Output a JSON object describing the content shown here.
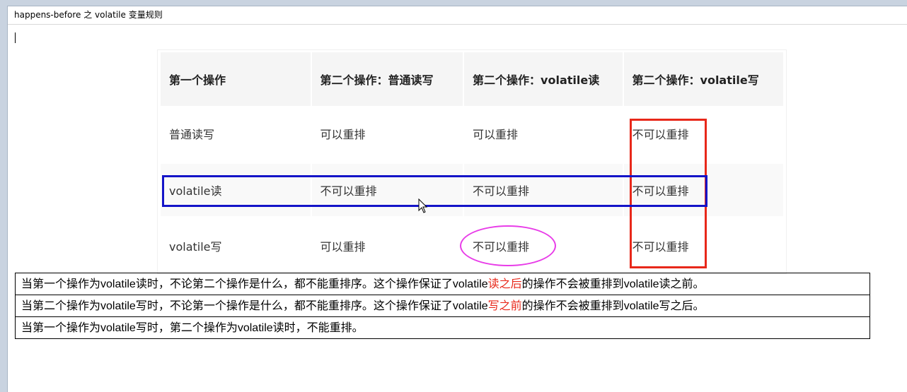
{
  "window": {
    "title": "happens-before 之 volatile 变量规则"
  },
  "table": {
    "headers": [
      "第一个操作",
      "第二个操作：普通读写",
      "第二个操作：volatile读",
      "第二个操作：volatile写"
    ],
    "rows": [
      [
        "普通读写",
        "可以重排",
        "可以重排",
        "不可以重排"
      ],
      [
        "volatile读",
        "不可以重排",
        "不可以重排",
        "不可以重排"
      ],
      [
        "volatile写",
        "可以重排",
        "不可以重排",
        "不可以重排"
      ]
    ]
  },
  "annotations": {
    "red_box_color": "#e8281a",
    "blue_box_color": "#1414c8",
    "ellipse_color": "#e83ce8",
    "highlight_color": "#e8281a"
  },
  "rules": {
    "r1": {
      "a": "当第一个操作为",
      "b": "volatile",
      "c": "读时，不论第二个操作是什么，都不能重排序。这个操作保证了",
      "d": "volatile",
      "e": "读之后",
      "f": "的操作不会被重排到",
      "g": "volatile",
      "h": "读之前。"
    },
    "r2": {
      "a": "当第二个操作为",
      "b": "volatile",
      "c": "写时，不论第一个操作是什么，都不能重排序。这个操作保证了",
      "d": "volatile",
      "e": "写之前",
      "f": "的操作不会被重排到",
      "g": "volatile",
      "h": "写之后。"
    },
    "r3": {
      "a": "当第一个操作为",
      "b": "volatile",
      "c": "写时，第二个操作为",
      "d": "volatile",
      "e": "读时，不能重排。"
    }
  }
}
